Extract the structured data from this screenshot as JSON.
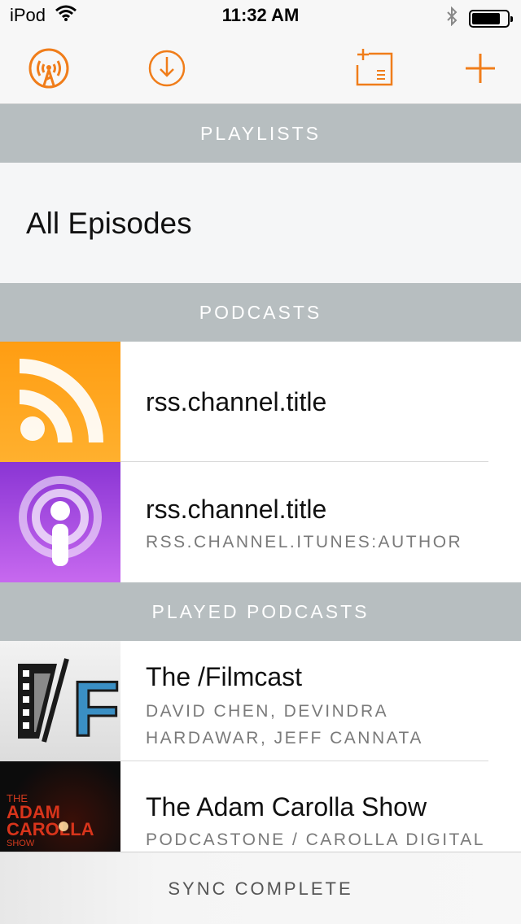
{
  "status_bar": {
    "carrier": "iPod",
    "time": "11:32 AM",
    "icons": [
      "wifi-icon",
      "bluetooth-icon",
      "battery-icon"
    ]
  },
  "toolbar": {
    "icons": [
      "overcast-icon",
      "download-icon",
      "add-playlist-icon",
      "add-icon"
    ],
    "accent_color": "#f07d1a"
  },
  "sections": {
    "playlists": "PLAYLISTS",
    "podcasts": "PODCASTS",
    "played_podcasts": "PLAYED PODCASTS"
  },
  "playlists": [
    {
      "label": "All Episodes"
    }
  ],
  "podcasts": [
    {
      "title": "rss.channel.title",
      "author": "",
      "art": "rss-feed-icon"
    },
    {
      "title": "rss.channel.title",
      "author": "RSS.CHANNEL.ITUNES:AUTHOR",
      "art": "podcast-icon"
    }
  ],
  "played_podcasts": [
    {
      "title": "The /Filmcast",
      "author": "DAVID CHEN, DEVINDRA HARDAWAR, JEFF CANNATA",
      "art": "filmcast-artwork"
    },
    {
      "title": "The Adam Carolla Show",
      "author": "PODCASTONE / CAROLLA DIGITAL",
      "art": "adam-carolla-artwork"
    }
  ],
  "artwork_text": {
    "filmcast_letter": "F",
    "carolla_line1": "THE",
    "carolla_line2": "ADAM",
    "carolla_line3": "CAROLLA",
    "carolla_line4": "SHOW"
  },
  "sync": {
    "label": "SYNC COMPLETE"
  },
  "colors": {
    "section_header_bg": "#b7bec0",
    "rss_orange": "#ffa31a",
    "podcast_purple": "#a24fe0"
  }
}
